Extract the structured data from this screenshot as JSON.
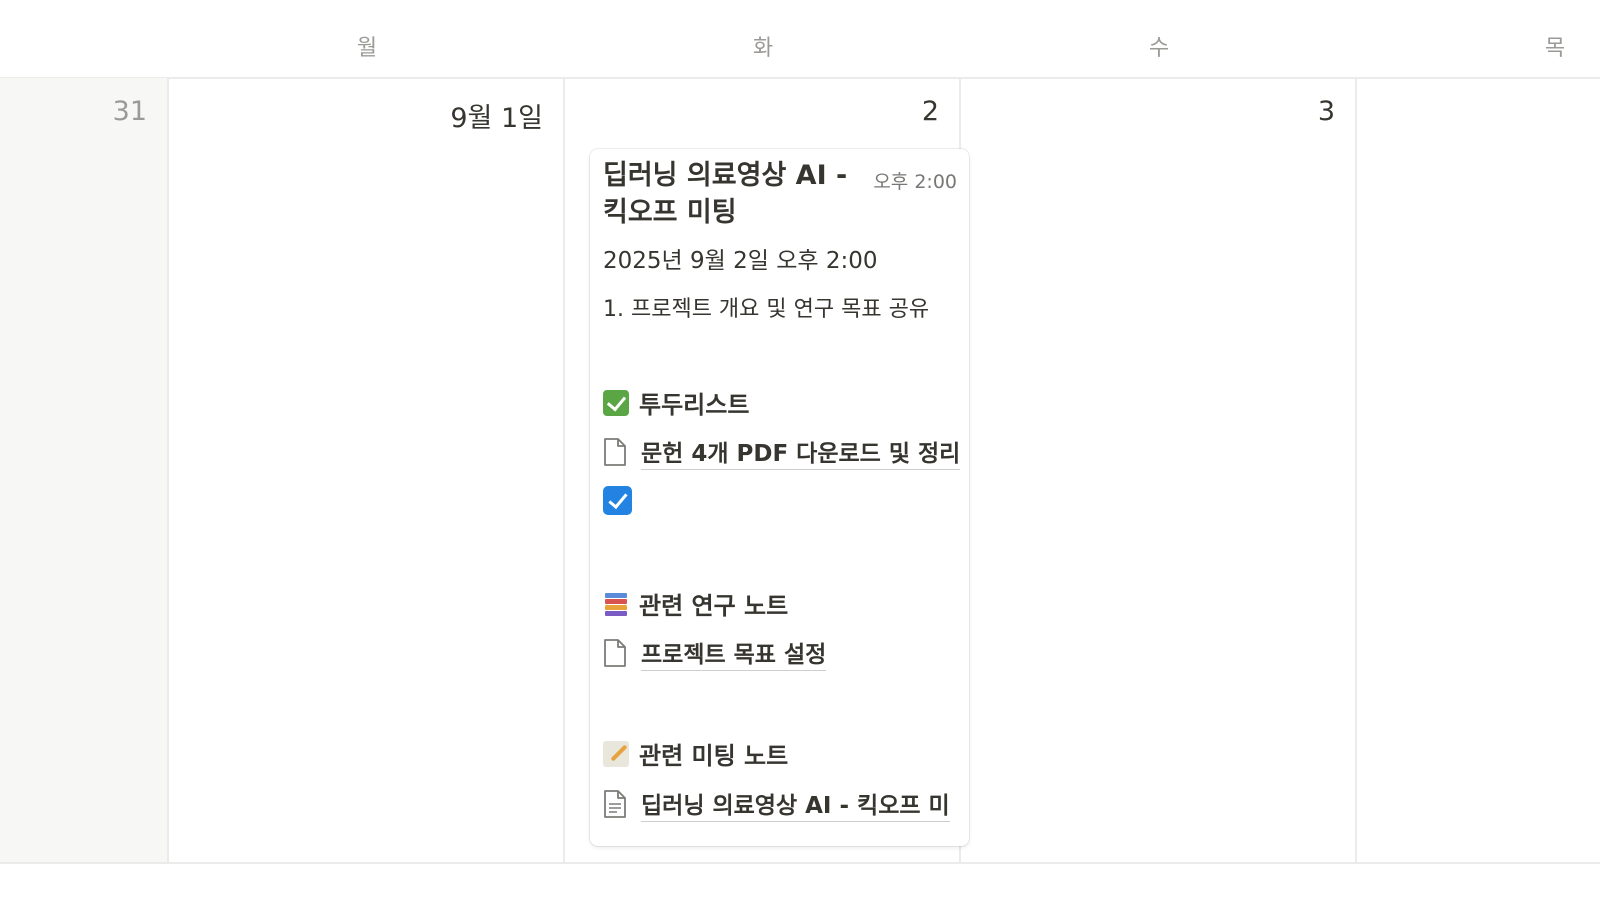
{
  "calendar": {
    "weekdays": [
      "월",
      "화",
      "수",
      "목"
    ],
    "dates": [
      "31",
      "9월 1일",
      "2",
      "3"
    ]
  },
  "event": {
    "title": "딥러닝 의료영상 AI - 킥오프 미팅",
    "time": "오후 2:00",
    "date": "2025년 9월 2일 오후 2:00",
    "description": "1. 프로젝트 개요 및 연구 목표 공유",
    "sections": {
      "todo": {
        "icon": "green-checkmark-icon",
        "label": "투두리스트"
      },
      "research": {
        "icon": "books-icon",
        "label": "관련 연구 노트"
      },
      "meeting": {
        "icon": "memo-icon",
        "label": "관련 미팅 노트"
      }
    },
    "todo_item": "문헌 4개 PDF 다운로드 및 정리",
    "todo_checkbox_checked": true,
    "research_item": "프로젝트 목표 설정",
    "meeting_item": "딥러닝 의료영상 AI - 킥오프 미"
  },
  "colors": {
    "checkbox_blue": "#2383e2",
    "check_green": "#5aa645",
    "border": "#ebebea",
    "muted_bg": "#f7f7f5"
  }
}
